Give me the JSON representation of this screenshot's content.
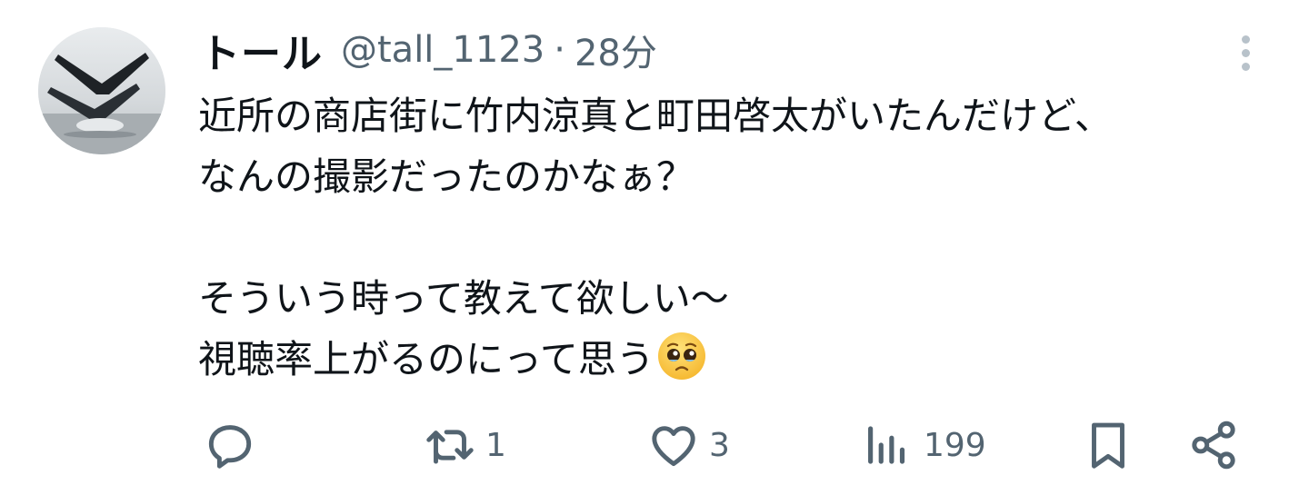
{
  "tweet": {
    "display_name": "トール",
    "handle": "@tall_1123",
    "separator": "·",
    "time_ago": "28分",
    "text_lines": [
      "近所の商店街に竹内涼真と町田啓太がいたんだけど、",
      "なんの撮影だったのかなぁ？",
      "",
      "そういう時って教えて欲しい～",
      "視聴率上がるのにって思う"
    ],
    "emoji": "pleading-face"
  },
  "actions": {
    "reply_count": "",
    "retweet_count": "1",
    "like_count": "3",
    "view_count": "199"
  },
  "colors": {
    "text": "#0f1419",
    "secondary": "#536471",
    "dots": "#b8c2ca",
    "background": "#ffffff"
  }
}
